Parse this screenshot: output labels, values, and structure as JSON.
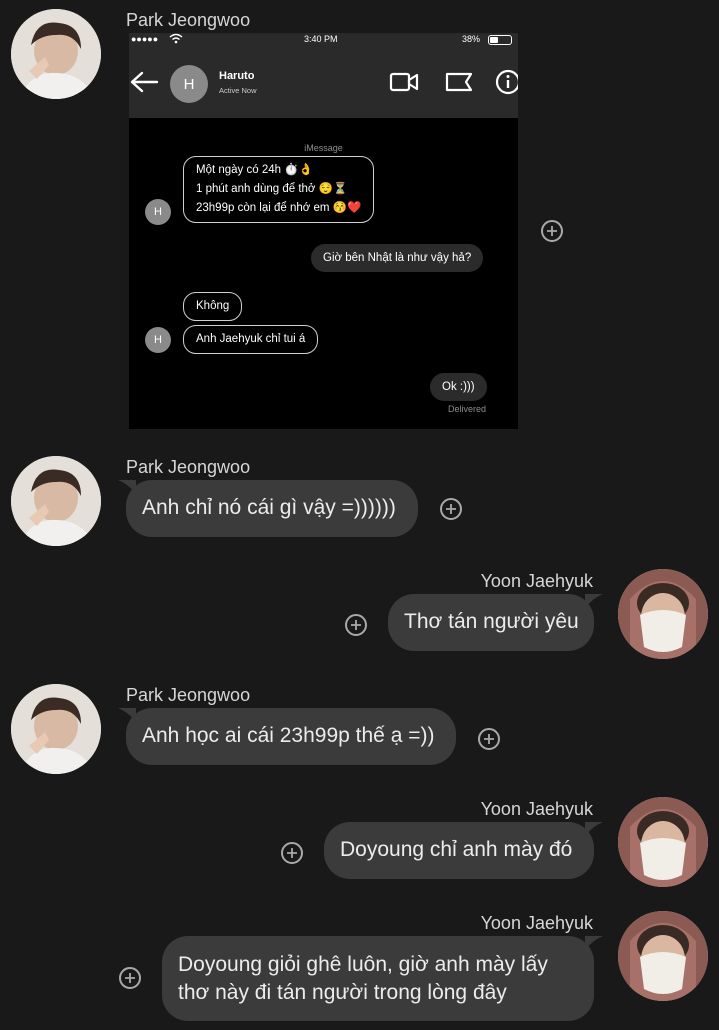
{
  "senders": {
    "park": "Park Jeongwoo",
    "yoon": "Yoon Jaehyuk"
  },
  "embedded_screenshot": {
    "status": {
      "signal": "●●●●● ",
      "time": "3:40 PM",
      "battery": "38%"
    },
    "contact": {
      "initial": "H",
      "name": "Haruto",
      "status": "Active Now"
    },
    "service_label": "iMessage",
    "messages": [
      {
        "side": "in",
        "lines": [
          "Một ngày có 24h ⏱️👌",
          "1 phút anh dùng để thở 😌⏳",
          "23h99p còn lại để nhớ em 😚❤️"
        ]
      },
      {
        "side": "out",
        "text": "Giờ bên Nhật là như vậy hả?"
      },
      {
        "side": "in",
        "text": "Không"
      },
      {
        "side": "in",
        "text": "Anh Jaehyuk chỉ tui á"
      },
      {
        "side": "out",
        "text": "Ok :)))"
      }
    ],
    "delivered_label": "Delivered"
  },
  "messages": {
    "m2": "Anh chỉ nó cái gì vậy =))))))",
    "m3": "Thơ tán người yêu",
    "m4": "Anh học ai cái 23h99p thế ạ =))",
    "m5": "Doyoung chỉ anh mày đó",
    "m6": "Doyoung giỏi ghê luôn, giờ anh mày lấy thơ này đi tán người trong lòng đây"
  },
  "icons": {
    "add_reaction": "plus-circle-icon",
    "back": "arrow-left-icon",
    "video": "video-camera-icon",
    "flag": "flag-icon",
    "info": "info-icon"
  },
  "colors": {
    "background": "#191919",
    "bubble": "#3b3b3b",
    "text": "#ececec"
  }
}
